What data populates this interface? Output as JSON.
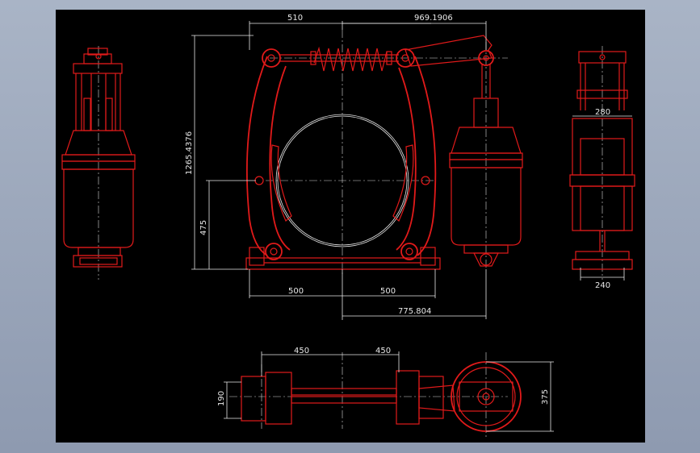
{
  "drawing": {
    "colors": {
      "outline": "#e11a1a",
      "dimension": "#e8e8e8",
      "background": "#000000",
      "frame": "#9aa5b9"
    },
    "dimensions": {
      "top_left_width": "510",
      "top_right_width": "969.1906",
      "total_height": "1265.4376",
      "center_height": "475",
      "base_left": "500",
      "base_right": "500",
      "right_offset": "775.804",
      "side_upper": "280",
      "side_lower": "240",
      "bottom_left": "450",
      "bottom_right": "450",
      "bottom_height": "190",
      "wheel_height": "375"
    }
  }
}
